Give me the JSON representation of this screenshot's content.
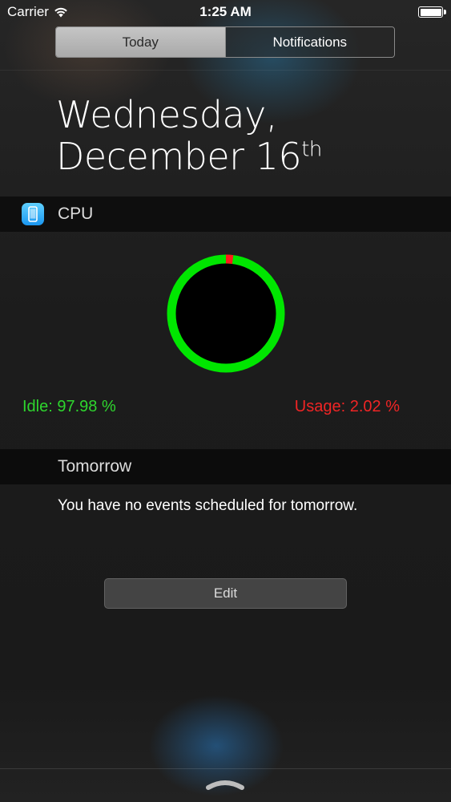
{
  "status_bar": {
    "carrier": "Carrier",
    "time": "1:25 AM"
  },
  "tabs": [
    {
      "label": "Today",
      "active": true
    },
    {
      "label": "Notifications",
      "active": false
    }
  ],
  "date": {
    "line1": "Wednesday,",
    "line2": "December 16",
    "suffix": "th"
  },
  "cpu_widget": {
    "title": "CPU",
    "idle_text": "Idle: 97.98 %",
    "usage_text": "Usage: 2.02 %",
    "usage_fraction": 0.0202,
    "colors": {
      "idle": "#00e600",
      "usage": "#ff1a1a"
    }
  },
  "tomorrow_widget": {
    "title": "Tomorrow",
    "message": "You have no events scheduled for tomorrow."
  },
  "edit_button": {
    "label": "Edit"
  }
}
